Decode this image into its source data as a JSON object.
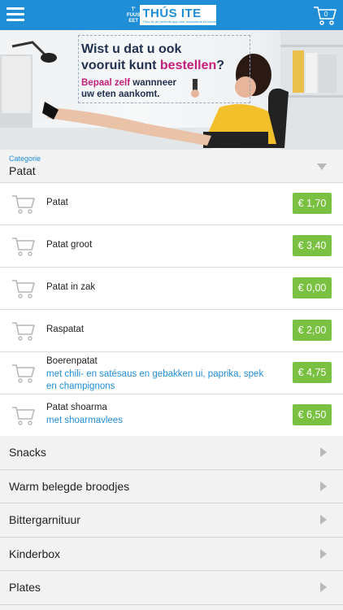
{
  "header": {
    "logo_badge": "T' FUUS EET",
    "logo_name": "THÚS ITE",
    "logo_sub": "Thús Ite de perfecte app voor restaurants en bezorg",
    "cart_count": "0",
    "menu_icon": "hamburger-menu-icon",
    "cart_icon": "shopping-cart-icon"
  },
  "banner": {
    "line1": "Wist u dat u ook",
    "line2a": "vooruit kunt ",
    "line2b": "bestellen",
    "line2c": "?",
    "sub1a": "Bepaal zelf ",
    "sub1b": "wannneer",
    "sub2": "uw eten aankomt."
  },
  "category": {
    "label": "Categorie",
    "value": "Patat"
  },
  "products": [
    {
      "name": "Patat",
      "desc": "",
      "price": "€ 1,70"
    },
    {
      "name": "Patat groot",
      "desc": "",
      "price": "€ 3,40"
    },
    {
      "name": "Patat in zak",
      "desc": "",
      "price": "€ 0,00"
    },
    {
      "name": "Raspatat",
      "desc": "",
      "price": "€ 2,00"
    },
    {
      "name": "Boerenpatat",
      "desc": "met chili- en satésaus en gebakken ui, paprika, spek en champignons",
      "price": "€ 4,75"
    },
    {
      "name": "Patat shoarma",
      "desc": "met shoarmavlees",
      "price": "€ 6,50"
    }
  ],
  "other_categories": [
    "Snacks",
    "Warm belegde broodjes",
    "Bittergarnituur",
    "Kinderbox",
    "Plates"
  ],
  "colors": {
    "brand_blue": "#1f8ed7",
    "price_green": "#7ac142",
    "accent_magenta": "#c51f7c"
  }
}
